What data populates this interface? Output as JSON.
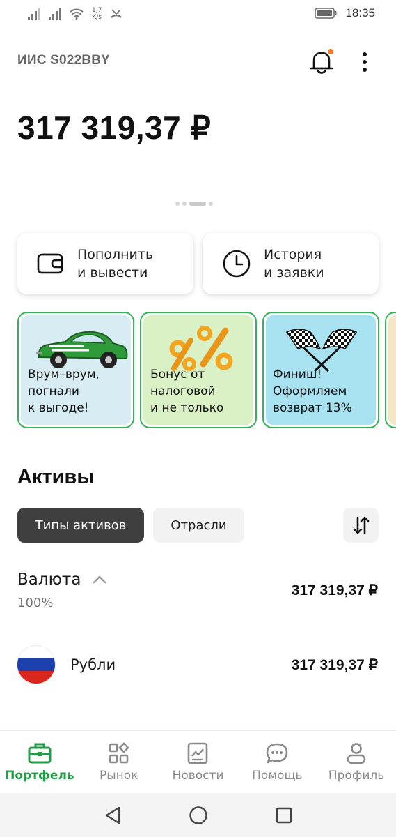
{
  "status_bar": {
    "net_speed_value": "1,7",
    "net_speed_unit": "K/s",
    "time": "18:35",
    "icons": [
      "signal-icon",
      "signal-icon",
      "wifi-icon",
      "missed-call-icon",
      "battery-icon"
    ]
  },
  "header": {
    "account_title": "ИИС S022BBY",
    "notification_badge_color": "#f07a2a"
  },
  "balance": {
    "amount": "317 319,37 ₽"
  },
  "pager": {
    "pages": 4,
    "active_index": 2
  },
  "actions": [
    {
      "label": "Пополнить\nи вывести",
      "icon": "wallet-icon"
    },
    {
      "label": "История\nи заявки",
      "icon": "clock-icon"
    }
  ],
  "stories": [
    {
      "text": "Врум–врум,\nпогнали\nк выгоде!",
      "bg": "#d7ecf3",
      "icon": "car-icon"
    },
    {
      "text": "Бонус от\nналоговой\nи не только",
      "bg": "#d9f1c4",
      "icon": "percent-icon"
    },
    {
      "text": "Финиш!\nОформляем\nвозврат 13%",
      "bg": "#a8e2f0",
      "icon": "checkered-flags-icon"
    }
  ],
  "assets": {
    "title": "Активы",
    "chips": [
      "Типы активов",
      "Отрасли"
    ],
    "active_chip": 0,
    "groups": [
      {
        "name": "Валюта",
        "percent": "100%",
        "value": "317 319,37 ₽",
        "items": [
          {
            "name": "Рубли",
            "value": "317 319,37 ₽",
            "icon": "russia-flag-icon"
          }
        ]
      }
    ]
  },
  "bottom_nav": {
    "active_index": 0,
    "items": [
      {
        "label": "Портфель",
        "icon": "briefcase-icon"
      },
      {
        "label": "Рынок",
        "icon": "market-icon"
      },
      {
        "label": "Новости",
        "icon": "news-icon"
      },
      {
        "label": "Помощь",
        "icon": "chat-icon"
      },
      {
        "label": "Профиль",
        "icon": "profile-icon"
      }
    ]
  },
  "colors": {
    "accent": "#1f9e45",
    "card_border": "#34b35a",
    "chip_active_bg": "#3f3f3f"
  }
}
